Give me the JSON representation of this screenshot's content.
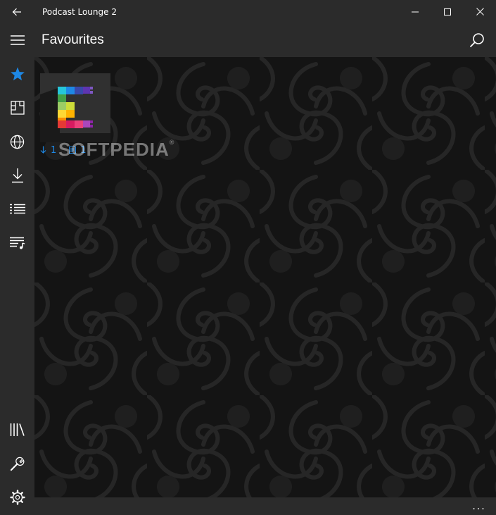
{
  "window": {
    "title": "Podcast Lounge 2"
  },
  "header": {
    "title": "Favourites"
  },
  "sidebar": {
    "items": [
      {
        "name": "favourites",
        "icon": "star-icon",
        "active": true
      },
      {
        "name": "podcasts",
        "icon": "podcast-grid-icon"
      },
      {
        "name": "discover",
        "icon": "globe-icon"
      },
      {
        "name": "downloads",
        "icon": "download-icon"
      },
      {
        "name": "list",
        "icon": "list-icon"
      },
      {
        "name": "playlist",
        "icon": "playlist-icon"
      },
      {
        "name": "library",
        "icon": "library-icon"
      },
      {
        "name": "tools",
        "icon": "wrench-icon"
      },
      {
        "name": "settings",
        "icon": "gear-icon"
      }
    ]
  },
  "favourites": [
    {
      "downloads": "1",
      "episodes": "1"
    }
  ],
  "watermark": {
    "text": "SOFTPEDIA",
    "mark": "®"
  },
  "appbar": {
    "more": "..."
  },
  "colors": {
    "accent": "#1e88e5",
    "chrome": "#2b2b2b",
    "content_bg": "#141414"
  }
}
